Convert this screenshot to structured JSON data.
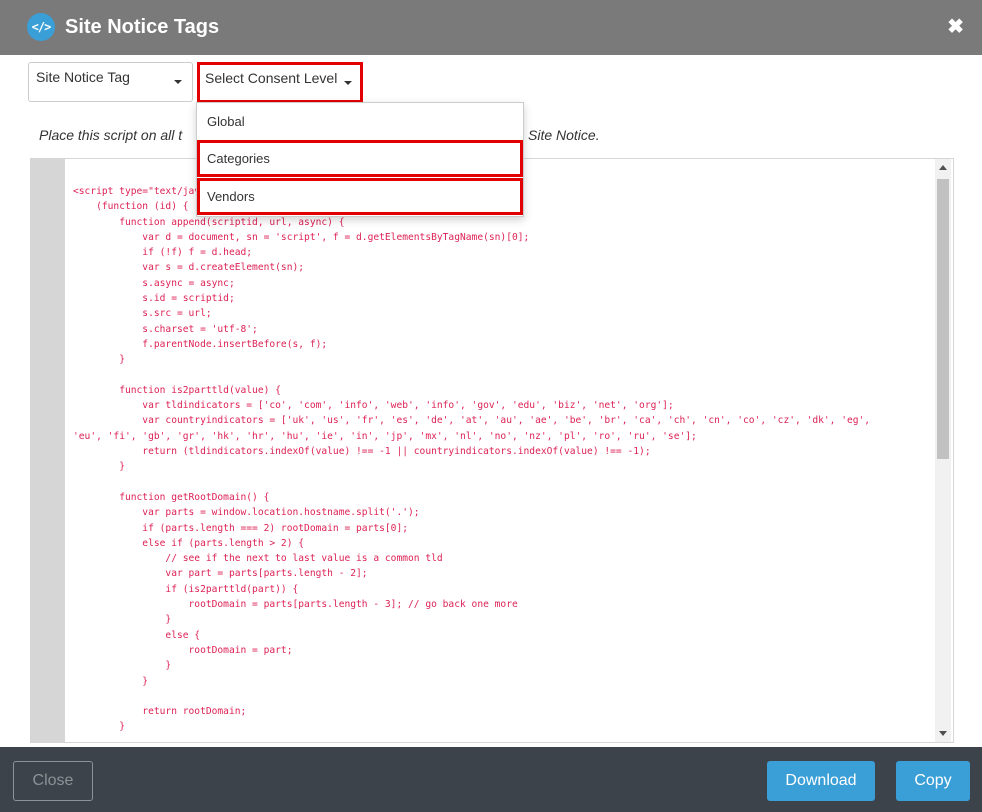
{
  "header": {
    "logo_glyph": "</>",
    "title": "Site Notice Tags",
    "close_glyph": "✖"
  },
  "controls": {
    "tag_select": {
      "value": "Site Notice Tag"
    },
    "consent_select": {
      "value": "Select Consent Level"
    }
  },
  "dropdown": {
    "options": [
      {
        "label": "Global",
        "highlighted": false
      },
      {
        "label": "Categories",
        "highlighted": true
      },
      {
        "label": "Vendors",
        "highlighted": true
      }
    ]
  },
  "instructions": {
    "visible_start": "Place this script on all t",
    "visible_end": "Site Notice."
  },
  "code": {
    "lines": [
      "<script type=\"text/javascript\">",
      "    (function (id) {",
      "        function append(scriptid, url, async) {",
      "            var d = document, sn = 'script', f = d.getElementsByTagName(sn)[0];",
      "            if (!f) f = d.head;",
      "            var s = d.createElement(sn);",
      "            s.async = async;",
      "            s.id = scriptid;",
      "            s.src = url;",
      "            s.charset = 'utf-8';",
      "            f.parentNode.insertBefore(s, f);",
      "        }",
      "",
      "        function is2parttld(value) {",
      "            var tldindicators = ['co', 'com', 'info', 'web', 'info', 'gov', 'edu', 'biz', 'net', 'org'];",
      "            var countryindicators = ['uk', 'us', 'fr', 'es', 'de', 'at', 'au', 'ae', 'be', 'br', 'ca', 'ch', 'cn', 'co', 'cz', 'dk', 'eg',",
      "'eu', 'fi', 'gb', 'gr', 'hk', 'hr', 'hu', 'ie', 'in', 'jp', 'mx', 'nl', 'no', 'nz', 'pl', 'ro', 'ru', 'se'];",
      "            return (tldindicators.indexOf(value) !== -1 || countryindicators.indexOf(value) !== -1);",
      "        }",
      "",
      "        function getRootDomain() {",
      "            var parts = window.location.hostname.split('.');",
      "            if (parts.length === 2) rootDomain = parts[0];",
      "            else if (parts.length > 2) {",
      "                // see if the next to last value is a common tld",
      "                var part = parts[parts.length - 2];",
      "                if (is2parttld(part)) {",
      "                    rootDomain = parts[parts.length - 3]; // go back one more",
      "                }",
      "                else {",
      "                    rootDomain = part;",
      "                }",
      "            }",
      "",
      "            return rootDomain;",
      "        }"
    ]
  },
  "footer": {
    "close_label": "Close",
    "download_label": "Download",
    "copy_label": "Copy"
  },
  "colors": {
    "header_bg": "#7a7a7a",
    "accent": "#3a9fd6",
    "footer_bg": "#3d434a",
    "code_text": "#dd2255",
    "highlight_border": "#e30000"
  }
}
